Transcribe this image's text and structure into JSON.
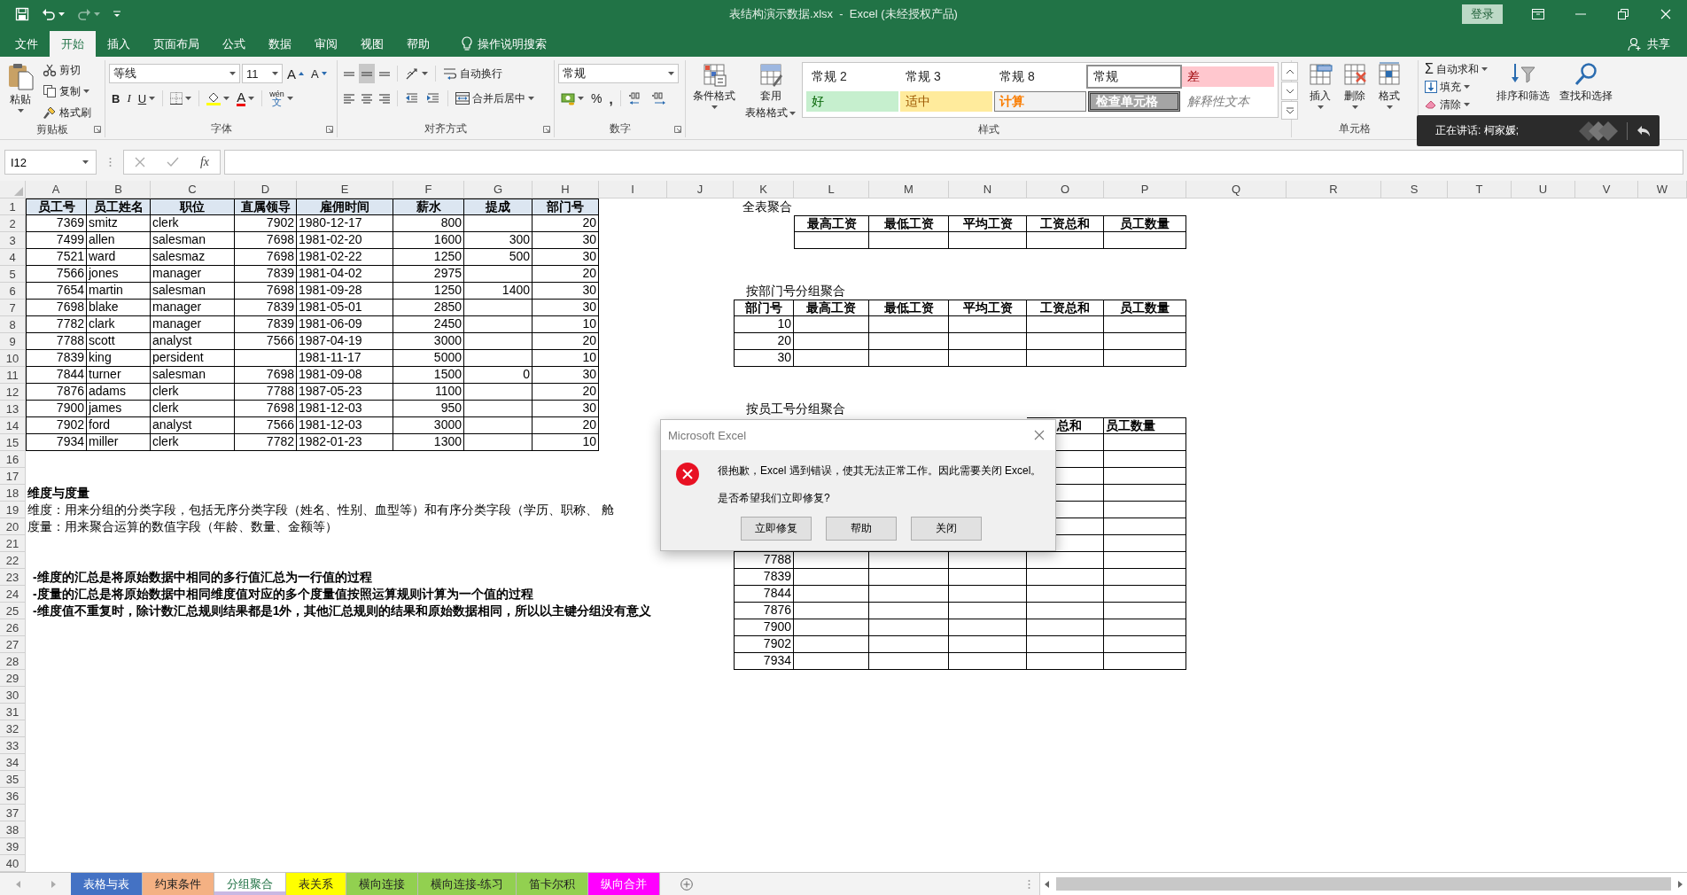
{
  "title_bar": {
    "title": "表结构演示数据.xlsx  -  Excel (未经授权产品)",
    "sign_in": "登录"
  },
  "ribbon_tabs": [
    {
      "label": "文件",
      "selected": false
    },
    {
      "label": "开始",
      "selected": true
    },
    {
      "label": "插入",
      "selected": false
    },
    {
      "label": "页面布局",
      "selected": false
    },
    {
      "label": "公式",
      "selected": false
    },
    {
      "label": "数据",
      "selected": false
    },
    {
      "label": "审阅",
      "selected": false
    },
    {
      "label": "视图",
      "selected": false
    },
    {
      "label": "帮助",
      "selected": false
    }
  ],
  "tell_me": "操作说明搜索",
  "share": "共享",
  "clipboard": {
    "label": "剪贴板",
    "paste": "粘贴",
    "cut": "剪切",
    "copy": "复制",
    "format_painter": "格式刷"
  },
  "font": {
    "label": "字体",
    "name": "等线",
    "size": "11",
    "grow": "A",
    "shrink": "A",
    "bold": "B",
    "italic": "I",
    "underline": "U",
    "font_color": "A",
    "phonetic": "wén",
    "phonetic_char": "文"
  },
  "alignment": {
    "label": "对齐方式",
    "wrap_text": "自动换行",
    "merge_center": "合并后居中"
  },
  "number": {
    "label": "数字",
    "format": "常规",
    "percent": "%",
    "comma": ","
  },
  "styles": {
    "label": "样式",
    "conditional": "条件格式",
    "table_format": [
      "套用",
      "表格格式"
    ],
    "gallery": [
      {
        "label": "常规 2",
        "kind": "normal",
        "selected": false
      },
      {
        "label": "常规 3",
        "kind": "normal",
        "selected": false
      },
      {
        "label": "常规 8",
        "kind": "normal",
        "selected": false
      },
      {
        "label": "常规",
        "kind": "normal",
        "selected": true
      },
      {
        "label": "差",
        "kind": "bad",
        "selected": false
      },
      {
        "label": "好",
        "kind": "good",
        "selected": false
      },
      {
        "label": "适中",
        "kind": "neutral",
        "selected": false
      },
      {
        "label": "计算",
        "kind": "calculation",
        "selected": false
      },
      {
        "label": "检查单元格",
        "kind": "check",
        "selected": false
      },
      {
        "label": "解释性文本",
        "kind": "explanatory",
        "selected": false
      }
    ]
  },
  "cells": {
    "label": "单元格",
    "insert": "插入",
    "delete": "删除",
    "format": "格式"
  },
  "editing": {
    "autosum_glyph": "Σ",
    "autosum": "自动求和",
    "fill": "填充",
    "clear": "清除",
    "sort_filter": "排序和筛选",
    "find_select": "查找和选择"
  },
  "speaker_tooltip": {
    "text": "正在讲话: 柯家媛;"
  },
  "formula_bar": {
    "name_box": "I12",
    "fx": "fx"
  },
  "columns": [
    "A",
    "B",
    "C",
    "D",
    "E",
    "F",
    "G",
    "H",
    "I",
    "J",
    "K",
    "L",
    "M",
    "N",
    "O",
    "P",
    "Q",
    "R",
    "S",
    "T",
    "U",
    "V",
    "W"
  ],
  "rows": [
    "1",
    "2",
    "3",
    "4",
    "5",
    "6",
    "7",
    "8",
    "9",
    "10",
    "11",
    "12",
    "13",
    "14",
    "15",
    "16",
    "17",
    "18",
    "19",
    "20",
    "21",
    "22",
    "23",
    "24",
    "25",
    "26",
    "27",
    "28",
    "29",
    "30",
    "31",
    "32",
    "33",
    "34",
    "35",
    "36",
    "37",
    "38",
    "39",
    "40"
  ],
  "employee_table": {
    "columns": [
      "员工号",
      "员工姓名",
      "职位",
      "直属领导",
      "雇佣时间",
      "薪水",
      "提成",
      "部门号"
    ],
    "rows": [
      [
        "7369",
        "smitz",
        "clerk",
        "7902",
        "1980-12-17",
        "800",
        null,
        "20"
      ],
      [
        "7499",
        "allen",
        "salesman",
        "7698",
        "1981-02-20",
        "1600",
        "300",
        "30"
      ],
      [
        "7521",
        "ward",
        "salesmaz",
        "7698",
        "1981-02-22",
        "1250",
        "500",
        "30"
      ],
      [
        "7566",
        "jones",
        "manager",
        "7839",
        "1981-04-02",
        "2975",
        null,
        "20"
      ],
      [
        "7654",
        "martin",
        "salesman",
        "7698",
        "1981-09-28",
        "1250",
        "1400",
        "30"
      ],
      [
        "7698",
        "blake",
        "manager",
        "7839",
        "1981-05-01",
        "2850",
        null,
        "30"
      ],
      [
        "7782",
        "clark",
        "manager",
        "7839",
        "1981-06-09",
        "2450",
        null,
        "10"
      ],
      [
        "7788",
        "scott",
        "analyst",
        "7566",
        "1987-04-19",
        "3000",
        null,
        "20"
      ],
      [
        "7839",
        "king",
        "persident",
        null,
        "1981-11-17",
        "5000",
        null,
        "10"
      ],
      [
        "7844",
        "turner",
        "salesman",
        "7698",
        "1981-09-08",
        "1500",
        "0",
        "30"
      ],
      [
        "7876",
        "adams",
        "clerk",
        "7788",
        "1987-05-23",
        "1100",
        null,
        "20"
      ],
      [
        "7900",
        "james",
        "clerk",
        "7698",
        "1981-12-03",
        "950",
        null,
        "30"
      ],
      [
        "7902",
        "ford",
        "analyst",
        "7566",
        "1981-12-03",
        "3000",
        null,
        "20"
      ],
      [
        "7934",
        "miller",
        "clerk",
        "7782",
        "1982-01-23",
        "1300",
        null,
        "10"
      ]
    ]
  },
  "notes": {
    "heading": "维度与度量",
    "dimension": "维度：用来分组的分类字段，包括无序分类字段（姓名、性别、血型等）和有序分类字段（学历、职称、 舱",
    "measure": "度量：用来聚合运算的数值字段（年龄、数量、金额等）",
    "points": [
      "-维度的汇总是将原始数据中相同的多行值汇总为一行值的过程",
      "-度量的汇总是将原始数据中相同维度值对应的多个度量值按照运算规则计算为一个值的过程",
      "-维度值不重复时，除计数汇总规则结果都是1外，其他汇总规则的结果和原始数据相同，所以以主键分组没有意义"
    ]
  },
  "aggregates": [
    {
      "title": "全表聚合",
      "columns": [
        "最高工资",
        "最低工资",
        "平均工资",
        "工资总和",
        "员工数量"
      ],
      "rows": [
        {
          "key": null
        }
      ]
    },
    {
      "title": "按部门号分组聚合",
      "columns": [
        "部门号",
        "最高工资",
        "最低工资",
        "平均工资",
        "工资总和",
        "员工数量"
      ],
      "rows": [
        {
          "key": "10"
        },
        {
          "key": "20"
        },
        {
          "key": "30"
        }
      ]
    },
    {
      "title": "按员工号分组聚合",
      "columns": [
        null,
        null,
        null,
        null,
        "总和",
        "员工数量"
      ],
      "rows": [
        {
          "key": null
        },
        {
          "key": null
        },
        {
          "key": null
        },
        {
          "key": null
        },
        {
          "key": null
        },
        {
          "key": null
        },
        {
          "key": null
        },
        {
          "key": "7788"
        },
        {
          "key": "7839"
        },
        {
          "key": "7844"
        },
        {
          "key": "7876"
        },
        {
          "key": "7900"
        },
        {
          "key": "7902"
        },
        {
          "key": "7934"
        }
      ]
    }
  ],
  "error_dialog": {
    "title": "Microsoft Excel",
    "message": "很抱歉，Excel 遇到错误，使其无法正常工作。因此需要关闭 Excel。",
    "question": "是否希望我们立即修复?",
    "buttons": [
      "立即修复",
      "帮助",
      "关闭"
    ]
  },
  "sheet_tabs": [
    {
      "label": "表格与表",
      "color": "#4472c4",
      "selected": false
    },
    {
      "label": "约束条件",
      "color": "#f4b183",
      "selected": false
    },
    {
      "label": "分组聚合",
      "color": "#c9b8e3",
      "selected": true
    },
    {
      "label": "表关系",
      "color": "#ffff00",
      "selected": false
    },
    {
      "label": "横向连接",
      "color": "#92d050",
      "selected": false
    },
    {
      "label": "横向连接-练习",
      "color": "#92d050",
      "selected": false
    },
    {
      "label": "笛卡尔积",
      "color": "#92d050",
      "selected": false
    },
    {
      "label": "纵向合并",
      "color": "#ff00ff",
      "selected": false
    }
  ]
}
